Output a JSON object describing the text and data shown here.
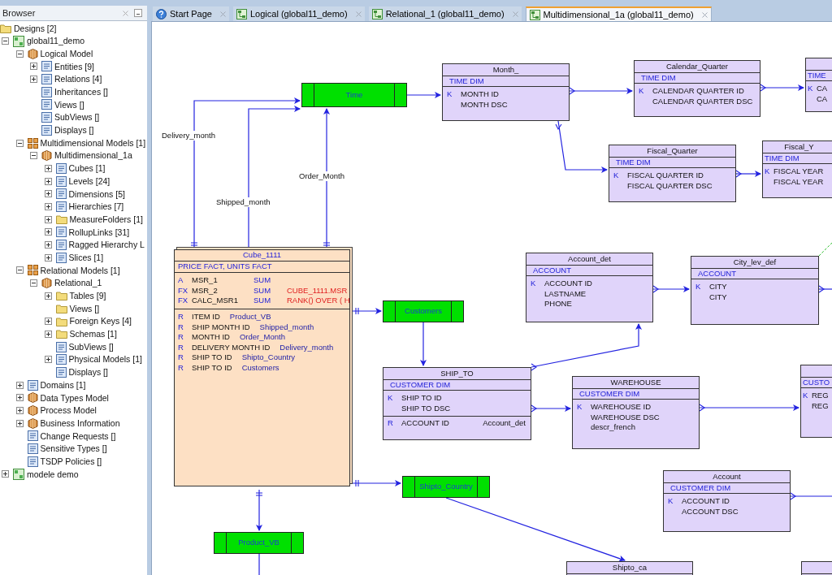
{
  "browser": {
    "title": "Browser",
    "tree": [
      {
        "label": "Designs [2]",
        "kind": "folder",
        "children": [
          {
            "label": "global11_demo",
            "kind": "design",
            "expanded": true,
            "children": [
              {
                "label": "Logical Model",
                "kind": "model",
                "expanded": true,
                "children": [
                  {
                    "label": "Entities [9]",
                    "kind": "collection",
                    "expanded": false
                  },
                  {
                    "label": "Relations [4]",
                    "kind": "collection",
                    "expanded": false
                  },
                  {
                    "label": "Inheritances []",
                    "kind": "collection"
                  },
                  {
                    "label": "Views []",
                    "kind": "collection"
                  },
                  {
                    "label": "SubViews []",
                    "kind": "collection"
                  },
                  {
                    "label": "Displays []",
                    "kind": "collection"
                  }
                ]
              },
              {
                "label": "Multidimensional Models [1]",
                "kind": "group",
                "expanded": true,
                "children": [
                  {
                    "label": "Multidimensional_1a",
                    "kind": "model",
                    "expanded": true,
                    "children": [
                      {
                        "label": "Cubes [1]",
                        "kind": "collection",
                        "expanded": false
                      },
                      {
                        "label": "Levels [24]",
                        "kind": "collection",
                        "expanded": false
                      },
                      {
                        "label": "Dimensions [5]",
                        "kind": "collection",
                        "expanded": false
                      },
                      {
                        "label": "Hierarchies [7]",
                        "kind": "collection",
                        "expanded": false
                      },
                      {
                        "label": "MeasureFolders [1]",
                        "kind": "folder",
                        "expanded": false
                      },
                      {
                        "label": "RollupLinks [31]",
                        "kind": "collection",
                        "expanded": false
                      },
                      {
                        "label": "Ragged Hierarchy L",
                        "kind": "collection",
                        "expanded": false
                      },
                      {
                        "label": "Slices [1]",
                        "kind": "collection",
                        "expanded": false
                      }
                    ]
                  }
                ]
              },
              {
                "label": "Relational Models [1]",
                "kind": "group",
                "expanded": true,
                "children": [
                  {
                    "label": "Relational_1",
                    "kind": "model",
                    "expanded": true,
                    "children": [
                      {
                        "label": "Tables [9]",
                        "kind": "folder",
                        "expanded": false
                      },
                      {
                        "label": "Views []",
                        "kind": "folder"
                      },
                      {
                        "label": "Foreign Keys [4]",
                        "kind": "folder",
                        "expanded": false
                      },
                      {
                        "label": "Schemas [1]",
                        "kind": "folder",
                        "expanded": false
                      },
                      {
                        "label": "SubViews []",
                        "kind": "collection"
                      },
                      {
                        "label": "Physical Models [1]",
                        "kind": "collection",
                        "expanded": false
                      },
                      {
                        "label": "Displays []",
                        "kind": "collection"
                      }
                    ]
                  }
                ]
              },
              {
                "label": "Domains [1]",
                "kind": "collection",
                "expanded": false
              },
              {
                "label": "Data Types Model",
                "kind": "model",
                "expanded": false
              },
              {
                "label": "Process Model",
                "kind": "model",
                "expanded": false
              },
              {
                "label": "Business Information",
                "kind": "model",
                "expanded": false
              },
              {
                "label": "Change Requests []",
                "kind": "collection"
              },
              {
                "label": "Sensitive Types []",
                "kind": "collection"
              },
              {
                "label": "TSDP Policies []",
                "kind": "collection"
              }
            ]
          },
          {
            "label": "modele demo",
            "kind": "design",
            "expanded": false
          }
        ]
      }
    ]
  },
  "tabs": [
    {
      "label": "Start Page",
      "kind": "start",
      "selected": false
    },
    {
      "label": "Logical (global11_demo)",
      "kind": "diagram",
      "selected": false
    },
    {
      "label": "Relational_1 (global11_demo)",
      "kind": "diagram",
      "selected": false
    },
    {
      "label": "Multidimensional_1a (global11_demo)",
      "kind": "diagram",
      "selected": true
    }
  ],
  "diagram": {
    "entities": [
      {
        "kind": "view",
        "name": "Time"
      },
      {
        "kind": "dimension",
        "name": "Month_",
        "section": "TIME DIM",
        "attributes": [
          {
            "type": "K",
            "name": "MONTH ID"
          },
          {
            "name": "MONTH DSC"
          }
        ]
      },
      {
        "kind": "dimension",
        "name": "Calendar_Quarter",
        "section": "TIME DIM",
        "attributes": [
          {
            "type": "K",
            "name": "CALENDAR QUARTER ID"
          },
          {
            "name": "CALENDAR QUARTER DSC"
          }
        ]
      },
      {
        "kind": "dimension",
        "section": "TIME",
        "attributes": [
          {
            "type": "K",
            "name": "CA"
          },
          {
            "name": "CA"
          }
        ]
      },
      {
        "kind": "dimension",
        "name": "Fiscal_Quarter",
        "section": "TIME DIM",
        "attributes": [
          {
            "type": "K",
            "name": "FISCAL QUARTER ID"
          },
          {
            "name": "FISCAL QUARTER DSC"
          }
        ]
      },
      {
        "kind": "dimension",
        "name": "Fiscal_Y",
        "section": "TIME DIM",
        "attributes": [
          {
            "type": "K",
            "name": "FISCAL YEAR"
          },
          {
            "name": "FISCAL YEAR"
          }
        ]
      },
      {
        "kind": "cube",
        "name": "Cube_1111",
        "section": "PRICE FACT, UNITS FACT",
        "measures": [
          {
            "type": "A",
            "name": "MSR_1",
            "aggregation": "SUM"
          },
          {
            "type": "FX",
            "name": "MSR_2",
            "aggregation": "SUM",
            "expression": "CUBE_1111.MSR"
          },
          {
            "type": "FX",
            "name": "CALC_MSR1",
            "aggregation": "SUM",
            "expression": "RANK() OVER ( H"
          }
        ],
        "references": [
          {
            "type": "R",
            "name": "ITEM ID",
            "target": "Product_VB"
          },
          {
            "type": "R",
            "name": "SHIP MONTH ID",
            "target": "Shipped_month"
          },
          {
            "type": "R",
            "name": "MONTH ID",
            "target": "Order_Month"
          },
          {
            "type": "R",
            "name": "DELIVERY MONTH ID",
            "target": "Delivery_month"
          },
          {
            "type": "R",
            "name": "SHIP TO ID",
            "target": "Shipto_Country"
          },
          {
            "type": "R",
            "name": "SHIP TO ID",
            "target": "Customers"
          }
        ]
      },
      {
        "kind": "dimension",
        "name": "Account_det",
        "section": "ACCOUNT",
        "attributes": [
          {
            "type": "K",
            "name": "ACCOUNT ID"
          },
          {
            "name": "LASTNAME"
          },
          {
            "name": "PHONE"
          }
        ]
      },
      {
        "kind": "dimension",
        "name": "City_lev_def",
        "section": "ACCOUNT",
        "attributes": [
          {
            "type": "K",
            "name": "CITY"
          },
          {
            "name": "CITY"
          }
        ]
      },
      {
        "kind": "view",
        "name": "Customers"
      },
      {
        "kind": "dimension",
        "name": "SHIP_TO",
        "section": "CUSTOMER DIM",
        "attributes": [
          {
            "type": "K",
            "name": "SHIP TO ID"
          },
          {
            "name": "SHIP TO DSC"
          }
        ],
        "references": [
          {
            "type": "R",
            "name": "ACCOUNT ID",
            "target": "Account_det"
          }
        ]
      },
      {
        "kind": "dimension",
        "name": "WAREHOUSE",
        "section": "CUSTOMER DIM",
        "attributes": [
          {
            "type": "K",
            "name": "WAREHOUSE ID"
          },
          {
            "name": "WAREHOUSE DSC"
          },
          {
            "name": "descr_french"
          }
        ]
      },
      {
        "kind": "dimension",
        "section": "CUSTO",
        "attributes": [
          {
            "type": "K",
            "name": "REG"
          },
          {
            "name": "REG"
          }
        ]
      },
      {
        "kind": "view",
        "name": "Shipto_Country"
      },
      {
        "kind": "dimension",
        "name": "Account",
        "section": "CUSTOMER DIM",
        "attributes": [
          {
            "type": "K",
            "name": "ACCOUNT ID"
          },
          {
            "name": "ACCOUNT DSC"
          }
        ]
      },
      {
        "kind": "view",
        "name": "Product_VB"
      },
      {
        "kind": "dimension",
        "name": "Shipto_ca"
      },
      {
        "kind": "dimension"
      }
    ],
    "connector_labels": [
      "Delivery_month",
      "Shipped_month",
      "Order_Month"
    ]
  }
}
